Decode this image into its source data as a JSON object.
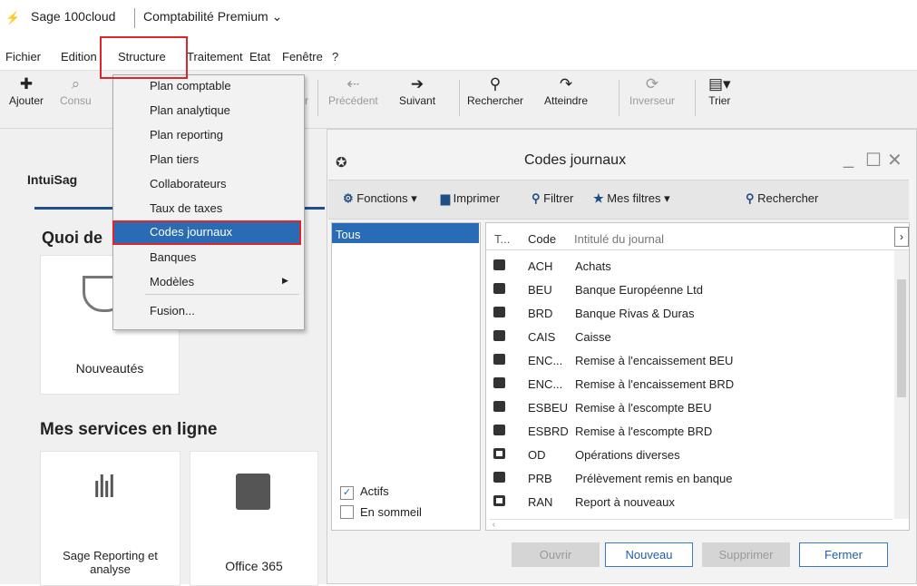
{
  "app": {
    "name": "Sage 100cloud",
    "module": "Comptabilité Premium ⌄"
  },
  "menubar": [
    "Fichier",
    "Edition",
    "Structure",
    "Traitement",
    "Etat",
    "Fenêtre",
    "?"
  ],
  "toolbar": {
    "add": "Ajouter",
    "consult": "Consu",
    "prev": "Précédent",
    "next": "Suivant",
    "search": "Rechercher",
    "goto": "Atteindre",
    "invert": "Inverseur",
    "sort": "Trier",
    "hidden_r": "r"
  },
  "structure_menu": [
    "Plan comptable",
    "Plan analytique",
    "Plan reporting",
    "Plan tiers",
    "Collaborateurs",
    "Taux de taxes",
    "Codes journaux",
    "Banques",
    "Modèles",
    "Fusion..."
  ],
  "left": {
    "intui": "IntuiSag",
    "quoi": "Quoi de",
    "news": "Nouveautés",
    "services_title": "Mes services en ligne",
    "reporting": "Sage Reporting et analyse",
    "office": "Office 365"
  },
  "dialog": {
    "title": "Codes journaux",
    "functions": "Fonctions ▾",
    "print": "Imprimer",
    "filter": "Filtrer",
    "myfilters": "Mes filtres ▾",
    "search": "Rechercher",
    "tous": "Tous",
    "actifs": "Actifs",
    "sommeil": "En sommeil",
    "headers": {
      "type": "T...",
      "code": "Code",
      "label": "Intitulé du journal"
    },
    "rows": [
      {
        "code": "ACH",
        "label": "Achats",
        "icon": "down"
      },
      {
        "code": "BEU",
        "label": "Banque Européenne Ltd",
        "icon": "bank"
      },
      {
        "code": "BRD",
        "label": "Banque Rivas & Duras",
        "icon": "bank"
      },
      {
        "code": "CAIS",
        "label": "Caisse",
        "icon": "bank"
      },
      {
        "code": "ENC...",
        "label": "Remise à l'encaissement BEU",
        "icon": "bank"
      },
      {
        "code": "ENC...",
        "label": "Remise à l'encaissement BRD",
        "icon": "bank"
      },
      {
        "code": "ESBEU",
        "label": "Remise à l'escompte BEU",
        "icon": "bank"
      },
      {
        "code": "ESBRD",
        "label": "Remise à l'escompte BRD",
        "icon": "bank"
      },
      {
        "code": "OD",
        "label": "Opérations diverses",
        "icon": "od"
      },
      {
        "code": "PRB",
        "label": "Prélèvement remis en banque",
        "icon": "bank"
      },
      {
        "code": "RAN",
        "label": "Report à nouveaux",
        "icon": "od"
      }
    ],
    "buttons": {
      "open": "Ouvrir",
      "new": "Nouveau",
      "delete": "Supprimer",
      "close": "Fermer"
    }
  }
}
